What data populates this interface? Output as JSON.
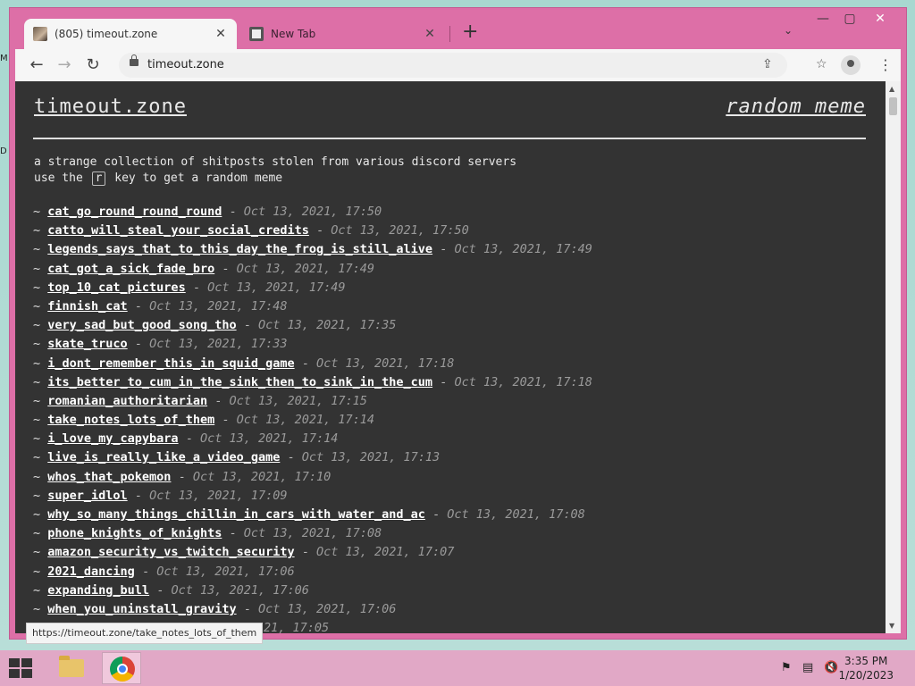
{
  "desktop": {
    "edge_glyph_1": "M",
    "edge_glyph_2": "D"
  },
  "browser": {
    "tabs": [
      {
        "title": "(805) timeout.zone",
        "active": true
      },
      {
        "title": "New Tab",
        "active": false
      }
    ],
    "new_tab": "+",
    "tab_search": "⌄",
    "window_controls": {
      "minimize": "—",
      "maximize": "▢",
      "close": "✕"
    },
    "address": "timeout.zone",
    "status_url": "https://timeout.zone/take_notes_lots_of_them"
  },
  "page": {
    "site_title": "timeout.zone",
    "random_link": "random meme",
    "intro_line1": "a strange collection of shitposts stolen from various discord servers",
    "intro_line2_pre": "use the",
    "intro_key": "r",
    "intro_line2_post": "key to get a random meme",
    "memes": [
      {
        "name": "cat_go_round_round_round",
        "date": "Oct 13, 2021, 17:50"
      },
      {
        "name": "catto_will_steal_your_social_credits",
        "date": "Oct 13, 2021, 17:50"
      },
      {
        "name": "legends_says_that_to_this_day_the_frog_is_still_alive",
        "date": "Oct 13, 2021, 17:49"
      },
      {
        "name": "cat_got_a_sick_fade_bro",
        "date": "Oct 13, 2021, 17:49"
      },
      {
        "name": "top_10_cat_pictures",
        "date": "Oct 13, 2021, 17:49"
      },
      {
        "name": "finnish_cat",
        "date": "Oct 13, 2021, 17:48"
      },
      {
        "name": "very_sad_but_good_song_tho",
        "date": "Oct 13, 2021, 17:35"
      },
      {
        "name": "skate_truco",
        "date": "Oct 13, 2021, 17:33"
      },
      {
        "name": "i_dont_remember_this_in_squid_game",
        "date": "Oct 13, 2021, 17:18"
      },
      {
        "name": "its_better_to_cum_in_the_sink_then_to_sink_in_the_cum",
        "date": "Oct 13, 2021, 17:18"
      },
      {
        "name": "romanian_authoritarian",
        "date": "Oct 13, 2021, 17:15"
      },
      {
        "name": "take_notes_lots_of_them",
        "date": "Oct 13, 2021, 17:14"
      },
      {
        "name": "i_love_my_capybara",
        "date": "Oct 13, 2021, 17:14"
      },
      {
        "name": "live_is_really_like_a_video_game",
        "date": "Oct 13, 2021, 17:13"
      },
      {
        "name": "whos_that_pokemon",
        "date": "Oct 13, 2021, 17:10"
      },
      {
        "name": "super_idlol",
        "date": "Oct 13, 2021, 17:09"
      },
      {
        "name": "why_so_many_things_chillin_in_cars_with_water_and_ac",
        "date": "Oct 13, 2021, 17:08"
      },
      {
        "name": "phone_knights_of_knights",
        "date": "Oct 13, 2021, 17:08"
      },
      {
        "name": "amazon_security_vs_twitch_security",
        "date": "Oct 13, 2021, 17:07"
      },
      {
        "name": "2021_dancing",
        "date": "Oct 13, 2021, 17:06"
      },
      {
        "name": "expanding_bull",
        "date": "Oct 13, 2021, 17:06"
      },
      {
        "name": "when_you_uninstall_gravity",
        "date": "Oct 13, 2021, 17:06"
      },
      {
        "name": "",
        "date": "21, 17:05"
      }
    ]
  },
  "taskbar": {
    "clock_time": "3:35 PM",
    "clock_date": "1/20/2023"
  },
  "colors": {
    "page_bg": "#333333",
    "window_frame": "#dd6fa7",
    "taskbar": "#e1a8c6"
  }
}
